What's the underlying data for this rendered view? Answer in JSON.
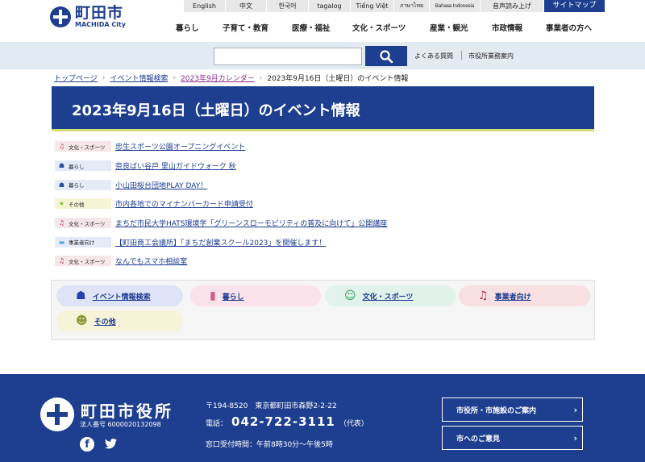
{
  "header": {
    "logo_name": "町田市",
    "logo_en": "MACHIDA City",
    "languages": [
      "English",
      "中文",
      "한국어",
      "tagalog",
      "Tiếng Việt",
      "ภาษาไทย",
      "Bahasa Indonesia",
      "音声読み上げ"
    ],
    "sitemap": "サイトマップ",
    "nav": [
      "暮らし",
      "子育て・教育",
      "医療・福祉",
      "文化・スポーツ",
      "産業・観光",
      "市政情報",
      "事業者の方へ"
    ]
  },
  "search": {
    "placeholder": "",
    "faq": "よくある質問",
    "office": "市役所業務案内"
  },
  "breadcrumb": {
    "items": [
      "トップページ",
      "イベント情報検索",
      "2023年9月カレンダー"
    ],
    "current": "2023年9月16日（土曜日）のイベント情報"
  },
  "page": {
    "title": "2023年9月16日（土曜日）のイベント情報"
  },
  "events": [
    {
      "category": "文化・スポーツ",
      "icon": "music-note-icon",
      "title": "忠生スポーツ公園オープニングイベント"
    },
    {
      "category": "暮らし",
      "icon": "house-icon",
      "title": "奈良ばい谷戸 里山ガイドウォーク 秋"
    },
    {
      "category": "暮らし",
      "icon": "house-icon",
      "title": "小山田桜台団地PLAY DAY！"
    },
    {
      "category": "その他",
      "icon": "star-icon",
      "title": "市内各地でのマイナンバーカード申請受付"
    },
    {
      "category": "文化・スポーツ",
      "icon": "music-note-icon",
      "title": "まちだ市民大学HATS環境学「グリーンスローモビリティの普及に向けて」公開講座"
    },
    {
      "category": "事業者向け",
      "icon": "briefcase-icon",
      "title": "【町田商工会議所】「まちだ創業スクール2023」を開催します！"
    },
    {
      "category": "文化・スポーツ",
      "icon": "music-note-icon",
      "title": "なんでもスマホ相談室"
    }
  ],
  "categories": {
    "event_search": "イベント情報検索",
    "life": "暮らし",
    "culture": "文化・スポーツ",
    "business": "事業者向け",
    "other": "その他"
  },
  "footer": {
    "name": "町田市役所",
    "corp_number": "法人番号 6000020132098",
    "address": "〒194-8520　東京都町田市森野2-2-22",
    "tel_label": "電話：",
    "tel": "042-722-3111",
    "tel_note": "（代表）",
    "hours": "窓口受付時間：午前8時30分～午後5時",
    "btn1": "市役所・市施設のご案内",
    "btn2": "市へのご意見"
  },
  "colors": {
    "brand": "#1e3f8f",
    "accent_line": "#d6df76"
  }
}
